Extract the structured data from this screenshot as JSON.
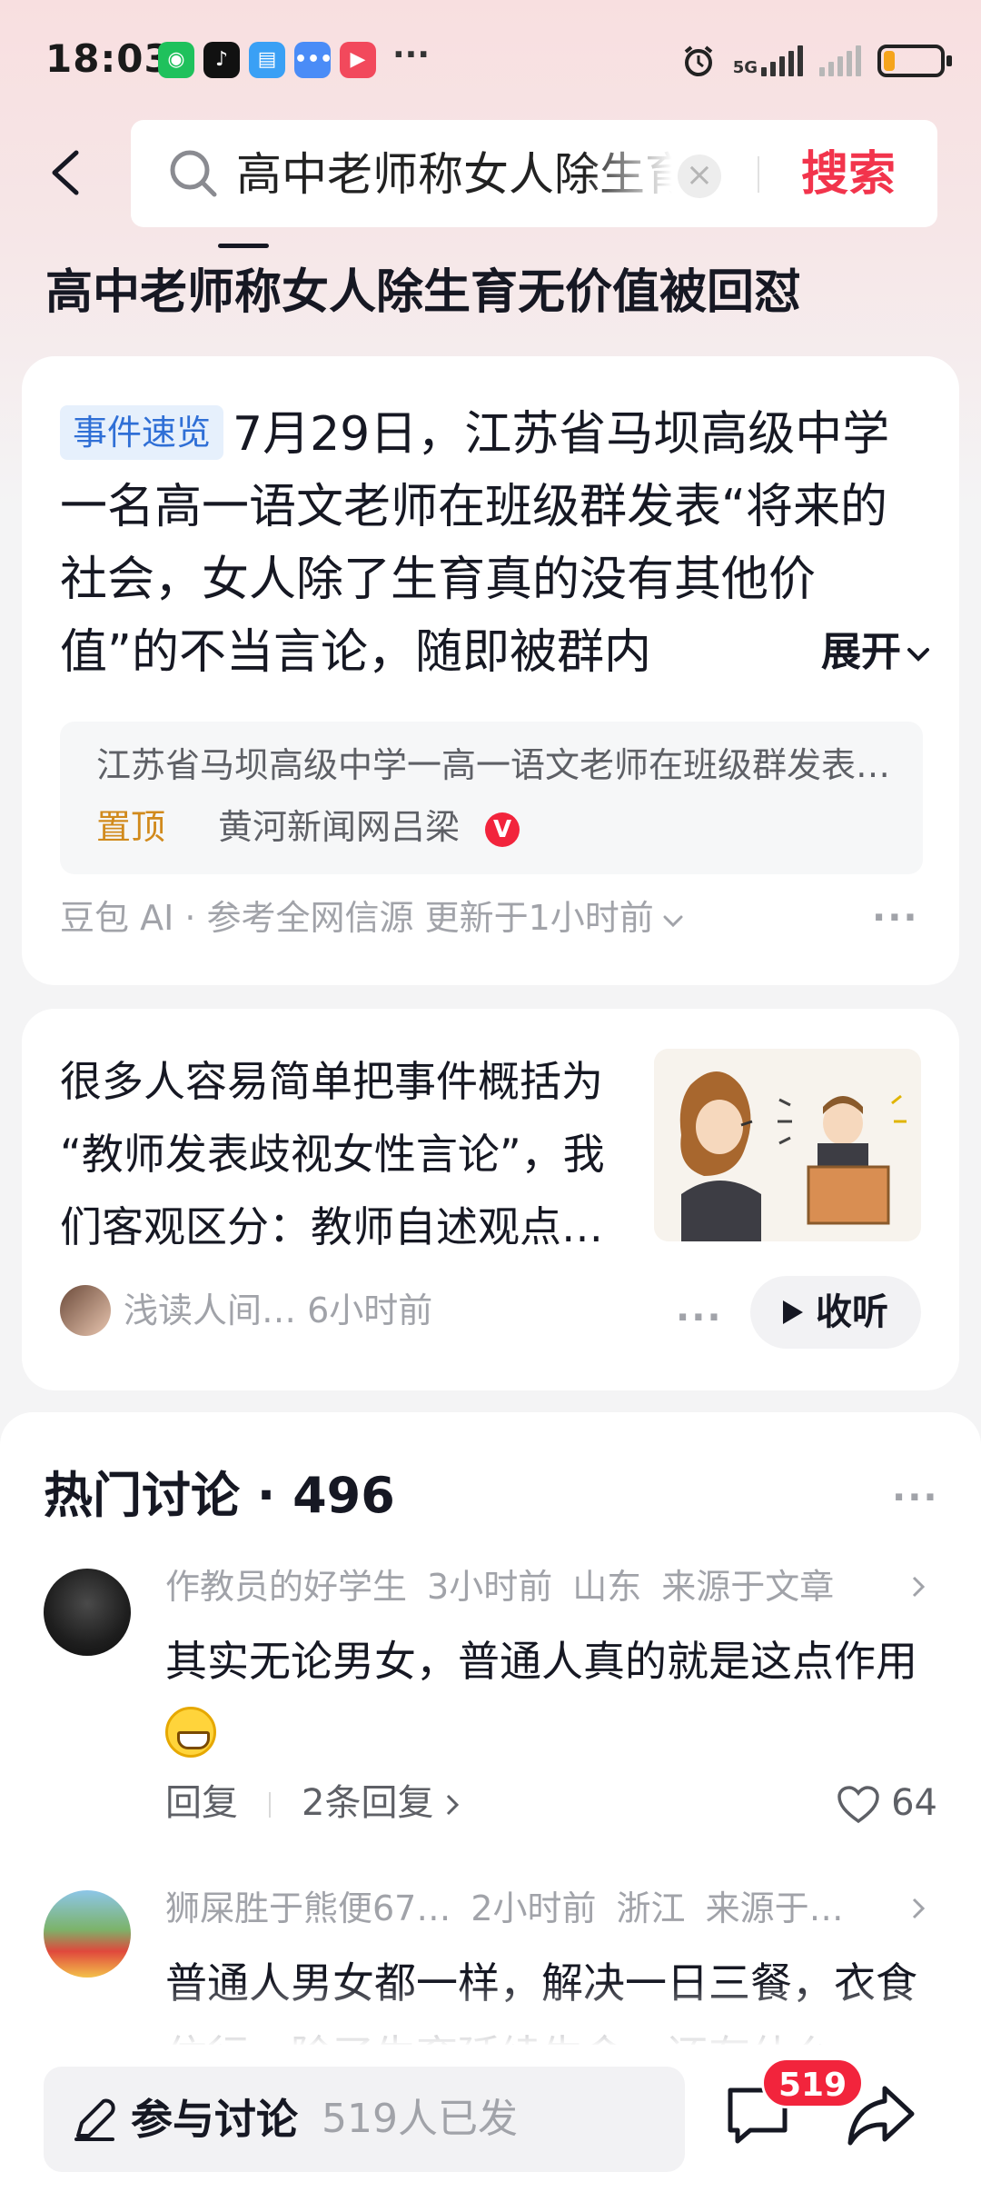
{
  "status_bar": {
    "time": "18:03",
    "network": "5G",
    "battery_level": 0.2,
    "apps": [
      "wechat-icon",
      "douyin-icon",
      "reader-icon",
      "message-icon",
      "video-icon"
    ]
  },
  "search": {
    "query": "高中老师称女人除生育无价值被回怼",
    "button": "搜索"
  },
  "page_title": "高中老师称女人除生育无价值被回怼",
  "summary_card": {
    "tag": "事件速览",
    "text": "7月29日，江苏省马坝高级中学一名高一语文老师在班级群发表“将来的社会，女人除了生育真的没有其他价值”的不当言论，随即被群内",
    "expand": "展开",
    "source_title": "江苏省马坝高级中学一高一语文老师在班级群发表不当言论",
    "pin_label": "置顶",
    "source_name": "黄河新闻网吕梁",
    "verified_badge": "V",
    "meta": "豆包 AI · 参考全网信源  更新于1小时前"
  },
  "article_card": {
    "lines": [
      "很多人容易简单把事件概括为",
      "“教师发表歧视女性言论”，我",
      "们客观区分：教师自述观点…"
    ],
    "author": "浅读人间…",
    "time": "6小时前",
    "listen": "收听"
  },
  "discussion": {
    "title": "热门讨论 · 496",
    "comments": [
      {
        "user": "作教员的好学生",
        "time": "3小时前",
        "location": "山东",
        "source": "来源于文章",
        "text": "其实无论男女，普通人真的就是这点作用",
        "reply": "回复",
        "replies": "2条回复",
        "likes": "64"
      },
      {
        "user": "狮屎胜于熊便67…",
        "time": "2小时前",
        "location": "浙江",
        "source": "来源于…",
        "text": "普通人男女都一样，解决一日三餐，衣食住行，除了生育延续生命，还有什么"
      }
    ]
  },
  "bottom_bar": {
    "discuss": "参与讨论",
    "count_text": "519人已发",
    "badge": "519"
  },
  "colors": {
    "accent_red": "#f2344c",
    "tag_blue": "#2f6fd6",
    "pin_gold": "#d18a1c"
  }
}
